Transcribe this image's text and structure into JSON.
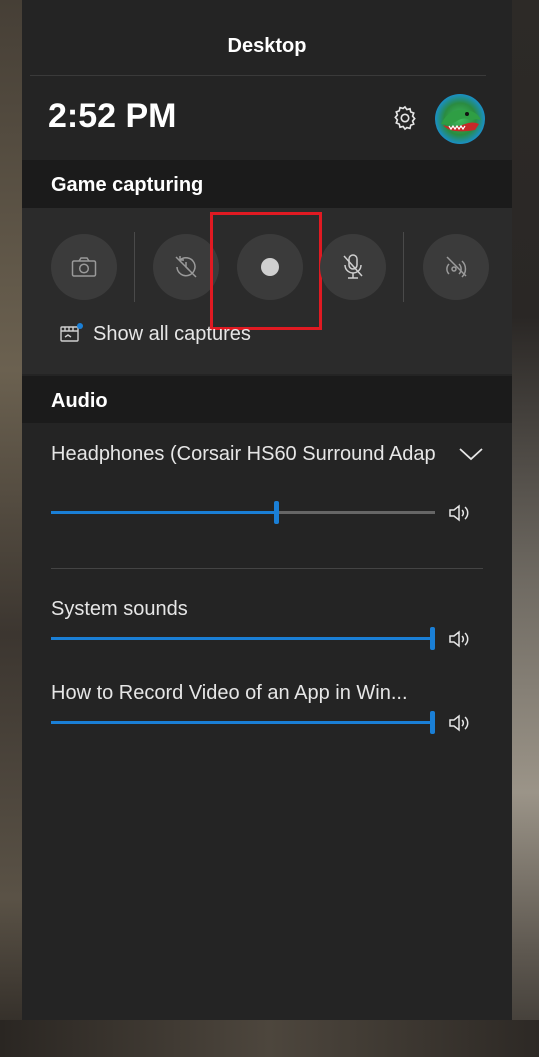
{
  "window": {
    "title": "Desktop"
  },
  "header": {
    "time": "2:52 PM",
    "settings_icon": "gear-icon",
    "avatar_icon": "user-avatar-icon"
  },
  "capture": {
    "section_label": "Game capturing",
    "buttons": [
      {
        "name": "screenshot",
        "icon": "camera-icon"
      },
      {
        "name": "record-last-30s",
        "icon": "record-that-icon"
      },
      {
        "name": "start-recording",
        "icon": "record-dot-icon"
      },
      {
        "name": "mic-toggle",
        "icon": "mic-off-icon"
      },
      {
        "name": "broadcast",
        "icon": "broadcast-icon"
      }
    ],
    "show_all_label": "Show all captures",
    "accent": "#1a7fd6",
    "highlight_color": "#e01a22"
  },
  "audio": {
    "section_label": "Audio",
    "device": {
      "label": "Headphones (Corsair HS60 Surround Adap",
      "volume": 0.58
    },
    "apps": [
      {
        "label": "System sounds",
        "volume": 1.0
      },
      {
        "label": "How to Record Video of an App in Win...",
        "volume": 1.0
      }
    ]
  }
}
